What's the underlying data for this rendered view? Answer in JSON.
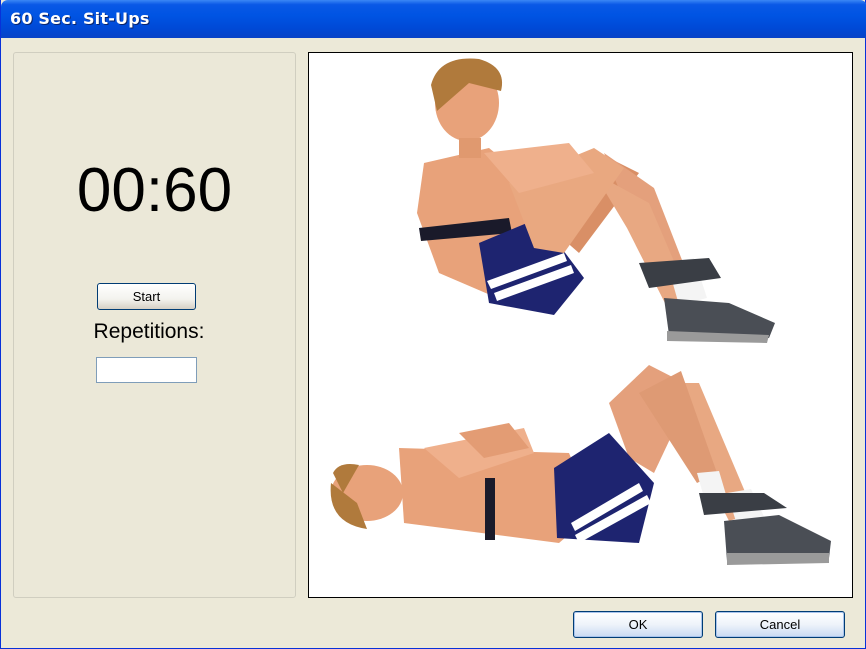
{
  "window": {
    "title": "60 Sec. Sit-Ups"
  },
  "timer": {
    "display": "00:60"
  },
  "controls": {
    "start_label": "Start",
    "repetitions_label": "Repetitions:",
    "repetitions_value": ""
  },
  "illustration": {
    "top_figure": "sit-up-up-position-photo",
    "bottom_figure": "sit-up-down-position-photo",
    "colors": {
      "skin": "#E8A27A",
      "shorts": "#1E2470",
      "hair": "#B07A3C",
      "shoe": "#4A4E55",
      "sock": "#FFFFFF"
    }
  },
  "footer": {
    "ok_label": "OK",
    "cancel_label": "Cancel"
  }
}
